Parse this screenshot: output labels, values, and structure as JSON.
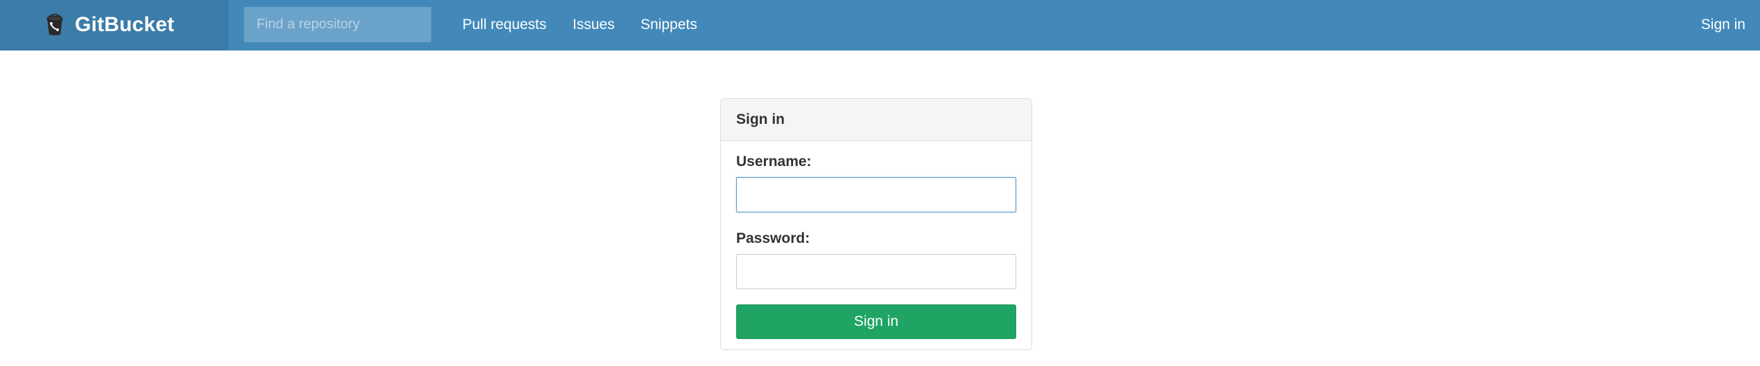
{
  "header": {
    "brand": "GitBucket",
    "brand_icon": "bucket-logo-icon",
    "search": {
      "placeholder": "Find a repository",
      "value": ""
    },
    "nav": {
      "pull_requests": "Pull requests",
      "issues": "Issues",
      "snippets": "Snippets"
    },
    "sign_in_link": "Sign in"
  },
  "signin_panel": {
    "title": "Sign in",
    "username_label": "Username:",
    "username_value": "",
    "password_label": "Password:",
    "password_value": "",
    "submit_label": "Sign in"
  },
  "colors": {
    "header_bg": "#4289b9",
    "brand_bg": "#3b7ca8",
    "search_bg": "#6aa2c9",
    "button_green": "#1fa463",
    "focus_border": "#5b97c4"
  }
}
